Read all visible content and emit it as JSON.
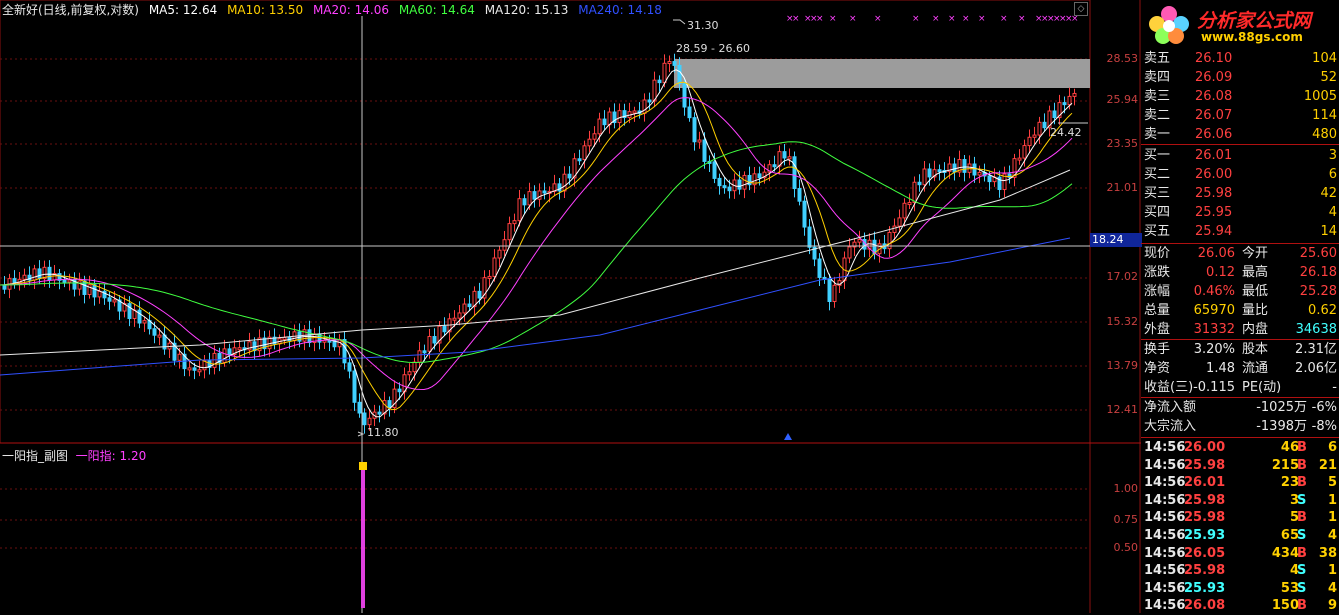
{
  "main_chart": {
    "title": "全新好(日线,前复权,对数)",
    "ma_labels": [
      {
        "text": "MA5: 12.64",
        "color": "#ffffff"
      },
      {
        "text": "MA10: 13.50",
        "color": "#ffd000"
      },
      {
        "text": "MA20: 14.06",
        "color": "#ff40ff"
      },
      {
        "text": "MA60: 14.64",
        "color": "#40ff40"
      },
      {
        "text": "MA120: 15.13",
        "color": "#e8e8e8"
      },
      {
        "text": "MA240: 14.18",
        "color": "#3050ff"
      }
    ],
    "y_axis_labels": [
      "28.53",
      "25.94",
      "23.35",
      "21.01",
      "18.24",
      "17.02",
      "15.32",
      "13.79",
      "12.41"
    ],
    "crosshair_price": "18.24",
    "high_marker": "31.30",
    "range_marker": "28.59 - 26.60",
    "low_marker": "11.80",
    "right_marker": "24.42",
    "chart_data": {
      "type": "candlestick",
      "title": "全新好(日线,前复权,对数)",
      "ylim": [
        11.8,
        31.3
      ],
      "annotated_points": {
        "high": 31.3,
        "low": 11.8,
        "zone_top": 28.59,
        "zone_bottom": 26.6,
        "recent": 24.42,
        "crosshair": 18.24
      }
    }
  },
  "sub_chart": {
    "title": "一阳指_副图",
    "indicator_label": "一阳指: 1.20",
    "indicator_color": "#ff40ff",
    "y_axis_labels": [
      "1.00",
      "0.75",
      "0.50"
    ]
  },
  "quote_panel": {
    "logo_text": "分析家公式网",
    "logo_url": "www.88gs.com",
    "asks": [
      {
        "label": "卖五",
        "price": "26.10",
        "vol": "104"
      },
      {
        "label": "卖四",
        "price": "26.09",
        "vol": "52"
      },
      {
        "label": "卖三",
        "price": "26.08",
        "vol": "1005"
      },
      {
        "label": "卖二",
        "price": "26.07",
        "vol": "114"
      },
      {
        "label": "卖一",
        "price": "26.06",
        "vol": "480"
      }
    ],
    "bids": [
      {
        "label": "买一",
        "price": "26.01",
        "vol": "3"
      },
      {
        "label": "买二",
        "price": "26.00",
        "vol": "6"
      },
      {
        "label": "买三",
        "price": "25.98",
        "vol": "42"
      },
      {
        "label": "买四",
        "price": "25.95",
        "vol": "4"
      },
      {
        "label": "买五",
        "price": "25.94",
        "vol": "14"
      }
    ],
    "stats1": [
      {
        "l1": "现价",
        "v1": "26.06",
        "c1": "#ff4040",
        "l2": "今开",
        "v2": "25.60",
        "c2": "#ff4040"
      },
      {
        "l1": "涨跌",
        "v1": "0.12",
        "c1": "#ff4040",
        "l2": "最高",
        "v2": "26.18",
        "c2": "#ff4040"
      },
      {
        "l1": "涨幅",
        "v1": "0.46%",
        "c1": "#ff4040",
        "l2": "最低",
        "v2": "25.28",
        "c2": "#ff4040"
      },
      {
        "l1": "总量",
        "v1": "65970",
        "c1": "#ffd000",
        "l2": "量比",
        "v2": "0.62",
        "c2": "#ffd000"
      },
      {
        "l1": "外盘",
        "v1": "31332",
        "c1": "#ff4040",
        "l2": "内盘",
        "v2": "34638",
        "c2": "#40ffff"
      }
    ],
    "stats2": [
      {
        "l1": "换手",
        "v1": "3.20%",
        "c1": "#e8e8e8",
        "l2": "股本",
        "v2": "2.31亿",
        "c2": "#e8e8e8"
      },
      {
        "l1": "净资",
        "v1": "1.48",
        "c1": "#e8e8e8",
        "l2": "流通",
        "v2": "2.06亿",
        "c2": "#e8e8e8"
      },
      {
        "l1": "收益(三)",
        "v1": "-0.115",
        "c1": "#e8e8e8",
        "l2": "PE(动)",
        "v2": "-",
        "c2": "#e8e8e8"
      }
    ],
    "flows": [
      {
        "label": "净流入额",
        "amount": "-1025万",
        "pct": "-6%"
      },
      {
        "label": "大宗流入",
        "amount": "-1398万",
        "pct": "-8%"
      }
    ],
    "ticks": [
      {
        "time": "14:56",
        "price": "26.00",
        "color": "#ff4040",
        "vol": "46",
        "side": "B",
        "side_color": "#ff4040",
        "extra": "6"
      },
      {
        "time": "14:56",
        "price": "25.98",
        "color": "#ff4040",
        "vol": "215",
        "side": "B",
        "side_color": "#ff4040",
        "extra": "21"
      },
      {
        "time": "14:56",
        "price": "26.01",
        "color": "#ff4040",
        "vol": "23",
        "side": "B",
        "side_color": "#ff4040",
        "extra": "5"
      },
      {
        "time": "14:56",
        "price": "25.98",
        "color": "#ff4040",
        "vol": "3",
        "side": "S",
        "side_color": "#40ffff",
        "extra": "1"
      },
      {
        "time": "14:56",
        "price": "25.98",
        "color": "#ff4040",
        "vol": "5",
        "side": "B",
        "side_color": "#ff4040",
        "extra": "1"
      },
      {
        "time": "14:56",
        "price": "25.93",
        "color": "#40ffff",
        "vol": "65",
        "side": "S",
        "side_color": "#40ffff",
        "extra": "4"
      },
      {
        "time": "14:56",
        "price": "26.05",
        "color": "#ff4040",
        "vol": "434",
        "side": "B",
        "side_color": "#ff4040",
        "extra": "38"
      },
      {
        "time": "14:56",
        "price": "25.98",
        "color": "#ff4040",
        "vol": "4",
        "side": "S",
        "side_color": "#40ffff",
        "extra": "1"
      },
      {
        "time": "14:56",
        "price": "25.93",
        "color": "#40ffff",
        "vol": "53",
        "side": "S",
        "side_color": "#40ffff",
        "extra": "4"
      },
      {
        "time": "14:56",
        "price": "26.08",
        "color": "#ff4040",
        "vol": "150",
        "side": "B",
        "side_color": "#ff4040",
        "extra": "9"
      }
    ]
  }
}
